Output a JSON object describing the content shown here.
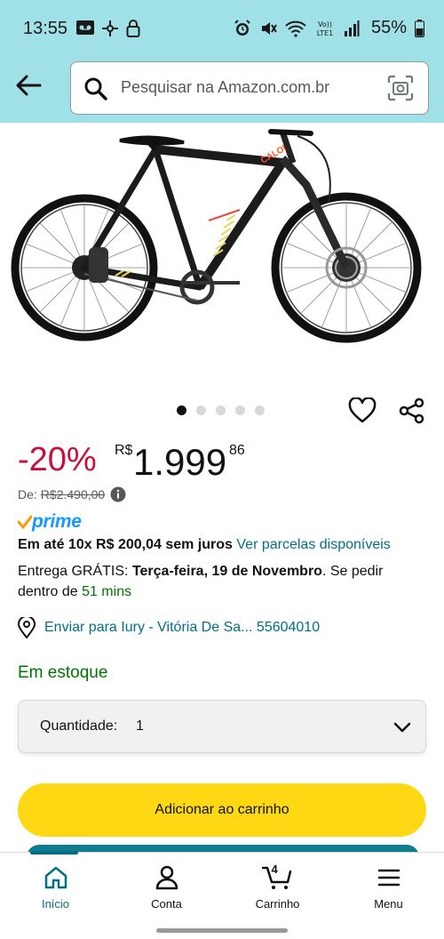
{
  "status_bar": {
    "time": "13:55",
    "battery": "55%",
    "left_icons": [
      "voicemail-icon",
      "gear-network-icon",
      "lock-icon"
    ],
    "right_icons": [
      "alarm-icon",
      "mute-icon",
      "wifi-icon",
      "volte-icon",
      "signal-icon",
      "battery-icon"
    ],
    "volte_label": "Vo)) LTE1"
  },
  "header": {
    "background": "#9fe1e6",
    "search_placeholder": "Pesquisar na Amazon.com.br"
  },
  "product": {
    "image": "mountain-bike-image",
    "bike_brand": "CALOI",
    "carousel": {
      "count": 5,
      "active": 0
    },
    "discount": "-20%",
    "currency": "R$",
    "price_whole": "1.999",
    "price_cents": "86",
    "list_price_label": "De:",
    "list_price": "R$2.490,00",
    "prime_label": "prime",
    "installments_bold": "Em até 10x R$ 200,04 sem juros",
    "installments_link": "Ver parcelas disponíveis",
    "delivery_prefix": "Entrega GRÁTIS: ",
    "delivery_date": "Terça-feira, 19 de Novembro",
    "delivery_mid": ". Se pedir dentro de ",
    "delivery_time": "51 mins",
    "ship_to": "Enviar para Iury - Vitória De Sa... 55604010",
    "stock": "Em estoque",
    "quantity_label": "Quantidade:",
    "quantity_value": "1",
    "add_to_cart": "Adicionar ao carrinho"
  },
  "colors": {
    "discount": "#cc0c39",
    "link": "#007185",
    "stock": "#007600",
    "cart_button": "#ffd814",
    "prime": "#1399ff"
  },
  "bottom_nav": {
    "items": [
      {
        "label": "Início",
        "icon": "home-icon"
      },
      {
        "label": "Conta",
        "icon": "user-icon"
      },
      {
        "label": "Carrinho",
        "icon": "cart-icon"
      },
      {
        "label": "Menu",
        "icon": "menu-icon"
      }
    ],
    "cart_count": "4"
  }
}
